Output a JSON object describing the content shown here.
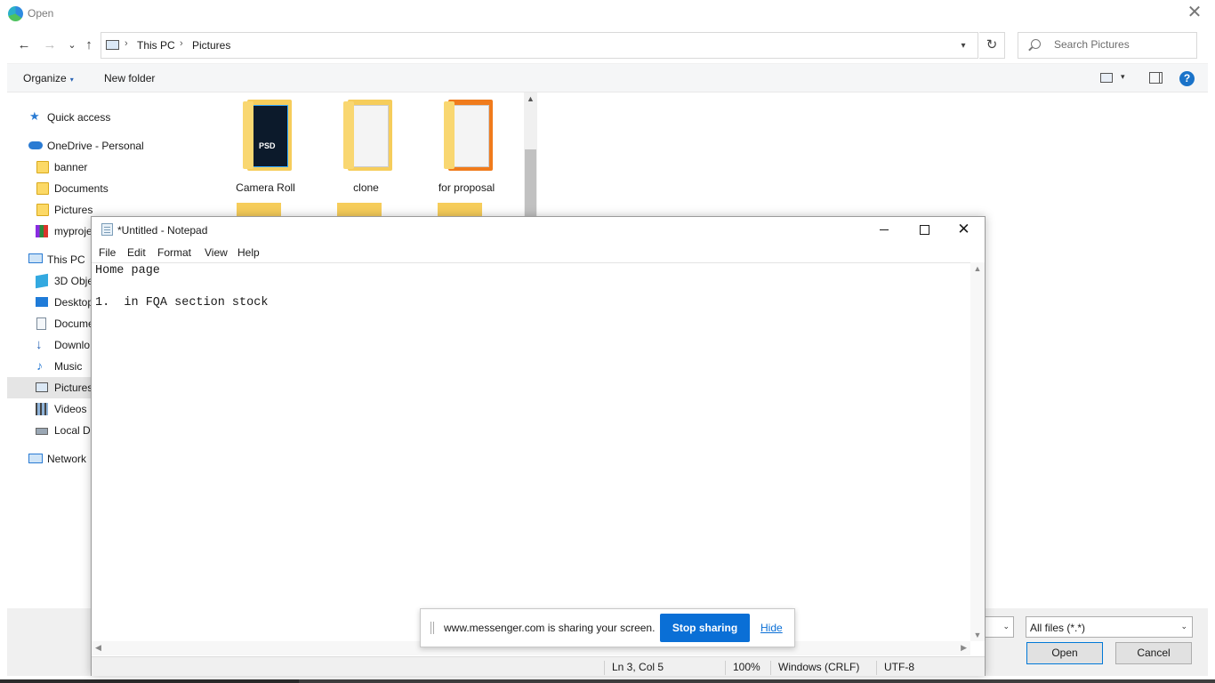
{
  "dialog": {
    "title": "Open",
    "close_glyph": "✕",
    "nav": {
      "back_glyph": "←",
      "forward_glyph": "→",
      "recent_glyph": "⌄",
      "up_glyph": "↑",
      "refresh_glyph": "↻",
      "dropdown_glyph": "▾",
      "breadcrumb": [
        "This PC",
        "Pictures"
      ],
      "separator": "›"
    },
    "search": {
      "placeholder": "Search Pictures"
    },
    "commands": {
      "organize": "Organize",
      "organize_arrow": "▾",
      "new_folder": "New folder",
      "view_arrow": "▾",
      "help": "?"
    },
    "sidebar": {
      "items": [
        {
          "label": "Quick access",
          "icon": "star-icon"
        },
        {
          "label": "OneDrive - Personal",
          "icon": "cloud-icon"
        },
        {
          "label": "banner",
          "icon": "folder-icon"
        },
        {
          "label": "Documents",
          "icon": "folder-icon"
        },
        {
          "label": "Pictures",
          "icon": "folder-icon"
        },
        {
          "label": "myproje",
          "icon": "archive-icon"
        },
        {
          "label": "This PC",
          "icon": "computer-icon"
        },
        {
          "label": "3D Obje",
          "icon": "cube-icon"
        },
        {
          "label": "Desktop",
          "icon": "desktop-icon"
        },
        {
          "label": "Docume",
          "icon": "document-icon"
        },
        {
          "label": "Downlo",
          "icon": "download-icon"
        },
        {
          "label": "Music",
          "icon": "music-icon"
        },
        {
          "label": "Pictures",
          "icon": "pictures-icon"
        },
        {
          "label": "Videos",
          "icon": "video-icon"
        },
        {
          "label": "Local Di",
          "icon": "drive-icon"
        },
        {
          "label": "Network",
          "icon": "network-icon"
        }
      ]
    },
    "files": [
      {
        "name": "Camera Roll",
        "badge": "PSD"
      },
      {
        "name": "clone"
      },
      {
        "name": "for proposal"
      }
    ],
    "scroll_up_glyph": "▲",
    "file_type": {
      "selected": "All files (*.*)",
      "arrow": "⌄"
    },
    "partial_combo_arrow": "⌄",
    "buttons": {
      "open": "Open",
      "cancel": "Cancel"
    }
  },
  "notepad": {
    "title": "*Untitled - Notepad",
    "close_glyph": "✕",
    "menu": [
      "File",
      "Edit",
      "Format",
      "View",
      "Help"
    ],
    "lines": [
      "Home page",
      "",
      "1.  in FQA section stock"
    ],
    "scroll": {
      "up": "▲",
      "down": "▼",
      "left": "◀",
      "right": "▶"
    },
    "status": {
      "position": "Ln 3, Col 5",
      "zoom": "100%",
      "line_endings": "Windows (CRLF)",
      "encoding": "UTF-8"
    }
  },
  "share_banner": {
    "text": "www.messenger.com is sharing your screen.",
    "stop_label": "Stop sharing",
    "hide_label": "Hide"
  },
  "colors": {
    "accent": "#0a6fd6",
    "folder": "#f6cd5b",
    "selected_bg": "#e5e5e5"
  }
}
